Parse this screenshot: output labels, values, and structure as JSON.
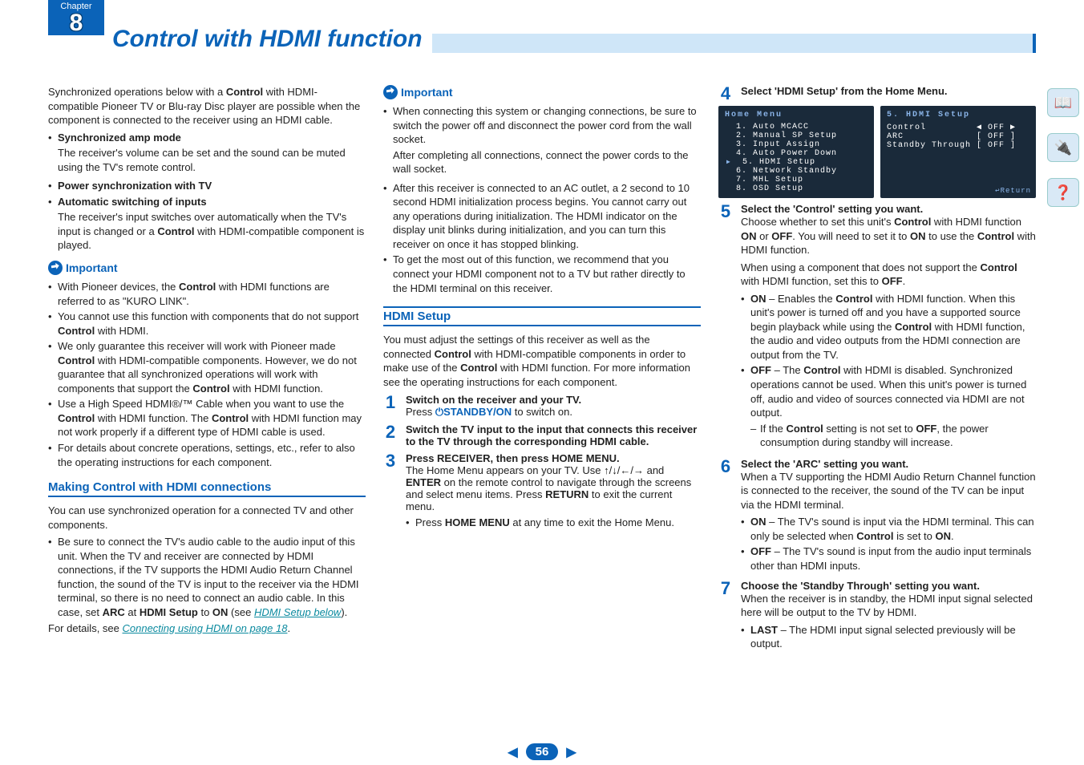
{
  "chapter": {
    "label": "Chapter",
    "number": "8"
  },
  "title": "Control with HDMI function",
  "col1": {
    "intro": {
      "pre": "Synchronized operations below with a ",
      "b1": "Control",
      "post": " with HDMI-compatible Pioneer TV or Blu-ray Disc player are possible when the component is connected to the receiver using an HDMI cable."
    },
    "bullets": [
      {
        "title": "Synchronized amp mode",
        "body": "The receiver's volume can be set and the sound can be muted using the TV's remote control."
      },
      {
        "title": "Power synchronization with TV",
        "body": ""
      },
      {
        "title": "Automatic switching of inputs",
        "body_pre": "The receiver's input switches over automatically when the TV's input is changed or a ",
        "body_b": "Control",
        "body_post": " with HDMI-compatible component is played."
      }
    ],
    "important_label": "Important",
    "important": [
      {
        "pre": "With Pioneer devices, the ",
        "b": "Control",
        "post": " with HDMI functions are referred to as \"KURO LINK\"."
      },
      {
        "pre": "You cannot use this function with components that do not support ",
        "b": "Control",
        "post": " with HDMI."
      },
      {
        "pre": "We only guarantee this receiver will work with Pioneer made ",
        "b": "Control",
        "post_pre": " with HDMI-compatible components. However, we do not guarantee that all synchronized operations will work with components that support the ",
        "post_b": "Control",
        "post_post": " with HDMI function."
      },
      {
        "pre": "Use a High Speed HDMI®/™ Cable when you want to use the ",
        "b": "Control",
        "mid": " with HDMI function. The ",
        "b2": "Control",
        "post": " with HDMI function may not work properly if a different type of HDMI cable is used."
      },
      {
        "plain": "For details about concrete operations, settings, etc., refer to also the operating instructions for each component."
      }
    ],
    "making_head": "Making Control with HDMI connections",
    "making_intro": "You can use synchronized operation for a connected TV and other components.",
    "making_bullet": {
      "pre": "Be sure to connect the TV's audio cable to the audio input of this unit. When the TV and receiver are connected by HDMI connections, if the TV supports the HDMI Audio Return Channel function, the sound of the TV is input to the receiver via the HDMI terminal, so there is no need to connect an audio cable. In this case, set ",
      "b1": "ARC",
      "mid1": " at ",
      "b2": "HDMI Setup",
      "mid2": " to ",
      "b3": "ON",
      "mid3": " (see ",
      "link": "HDMI Setup below",
      "post": ")."
    },
    "details_pre": "For details, see ",
    "details_link": "Connecting using HDMI on page 18",
    "details_post": "."
  },
  "col2": {
    "important_label": "Important",
    "imp1": "When connecting this system or changing connections, be sure to switch the power off and disconnect the power cord from the wall socket.",
    "imp1b": "After completing all connections, connect the power cords to the wall socket.",
    "imp2": "After this receiver is connected to an AC outlet, a 2 second to 10 second HDMI initialization process begins. You cannot carry out any operations during initialization. The HDMI indicator on the display unit blinks during initialization, and you can turn this receiver on once it has stopped blinking.",
    "imp3": "To get the most out of this function, we recommend that you connect your HDMI component not to a TV but rather directly to the HDMI terminal on this receiver.",
    "hdmi_head": "HDMI Setup",
    "hdmi_intro": {
      "pre": "You must adjust the settings of this receiver as well as the connected ",
      "b1": "Control",
      "mid": " with HDMI-compatible components in order to make use of the ",
      "b2": "Control",
      "post": " with HDMI function. For more information see the operating instructions for each component."
    },
    "step1": {
      "title": "Switch on the receiver and your TV.",
      "body_pre": "Press ",
      "body_b": "⏻STANDBY/ON",
      "body_post": " to switch on."
    },
    "step2": {
      "title": "Switch the TV input to the input that connects this receiver to the TV through the corresponding HDMI cable."
    },
    "step3": {
      "title_pre": "Press ",
      "title_b1": "RECEIVER",
      "title_mid": ", then press ",
      "title_b2": "HOME MENU",
      "title_post": ".",
      "body_pre": "The Home Menu appears on your TV. Use ",
      "arrows": "↑/↓/←/→",
      "body_mid": " and ",
      "b_enter": "ENTER",
      "body_mid2": " on the remote control to navigate through the screens and select menu items. Press ",
      "b_return": "RETURN",
      "body_post": " to exit the current menu.",
      "sub_pre": "Press ",
      "sub_b": "HOME MENU",
      "sub_post": " at any time to exit the Home Menu."
    }
  },
  "col3": {
    "step4": {
      "title": "Select 'HDMI Setup' from the Home Menu."
    },
    "osd1": {
      "title": "Home Menu",
      "lines": [
        "1. Auto MCACC",
        "2. Manual SP Setup",
        "3. Input Assign",
        "4. Auto Power Down",
        "5. HDMI Setup",
        "6. Network Standby",
        "7. MHL Setup",
        "8. OSD Setup"
      ],
      "cursor_idx": 4
    },
    "osd2": {
      "title": "5. HDMI Setup",
      "rows": [
        {
          "k": "Control",
          "v": "OFF",
          "sel": true
        },
        {
          "k": "ARC",
          "v": "OFF",
          "sel": false
        },
        {
          "k": "Standby Through",
          "v": "OFF",
          "sel": false
        }
      ],
      "return": "Return"
    },
    "step5": {
      "title": "Select the 'Control' setting you want.",
      "p1": {
        "pre": "Choose whether to set this unit's ",
        "b1": "Control",
        "mid1": " with HDMI function ",
        "b2": "ON",
        "mid2": " or ",
        "b3": "OFF",
        "mid3": ". You will need to set it to ",
        "b4": "ON",
        "mid4": " to use the ",
        "b5": "Control",
        "post": " with HDMI function."
      },
      "p2": {
        "pre": "When using a component that does not support the ",
        "b1": "Control",
        "mid": " with HDMI function, set this to ",
        "b2": "OFF",
        "post": "."
      },
      "on": {
        "label": "ON",
        "pre": " – Enables the ",
        "b": "Control",
        "mid": " with HDMI function. When this unit's power is turned off and you have a supported source begin playback while using the ",
        "b2": "Control",
        "post": " with HDMI function, the audio and video outputs from the HDMI connection are output from the TV."
      },
      "off": {
        "label": "OFF",
        "pre": " – The ",
        "b": "Control",
        "post": " with HDMI is disabled. Synchronized operations cannot be used. When this unit's power is turned off, audio and video of sources connected via HDMI are not output."
      },
      "dash": {
        "pre": "If the ",
        "b1": "Control",
        "mid": " setting is not set to ",
        "b2": "OFF",
        "post": ", the power consumption during standby will increase."
      }
    },
    "step6": {
      "title": "Select the 'ARC' setting you want.",
      "p": "When a TV supporting the HDMI Audio Return Channel function is connected to the receiver, the sound of the TV can be input via the HDMI terminal.",
      "on": {
        "label": "ON",
        "pre": " – The TV's sound is input via the HDMI terminal. This can only be selected when ",
        "b": "Control",
        "mid": " is set to ",
        "b2": "ON",
        "post": "."
      },
      "off": {
        "label": "OFF",
        "txt": " – The TV's sound is input from the audio input terminals other than HDMI inputs."
      }
    },
    "step7": {
      "title": "Choose the 'Standby Through' setting you want.",
      "p": "When the receiver is in standby, the HDMI input signal selected here will be output to the TV by HDMI.",
      "last": {
        "label": "LAST",
        "txt": " – The HDMI input signal selected previously will be output."
      }
    }
  },
  "page_number": "56",
  "side_icons": [
    "book-icon",
    "device-icon",
    "help-icon"
  ]
}
